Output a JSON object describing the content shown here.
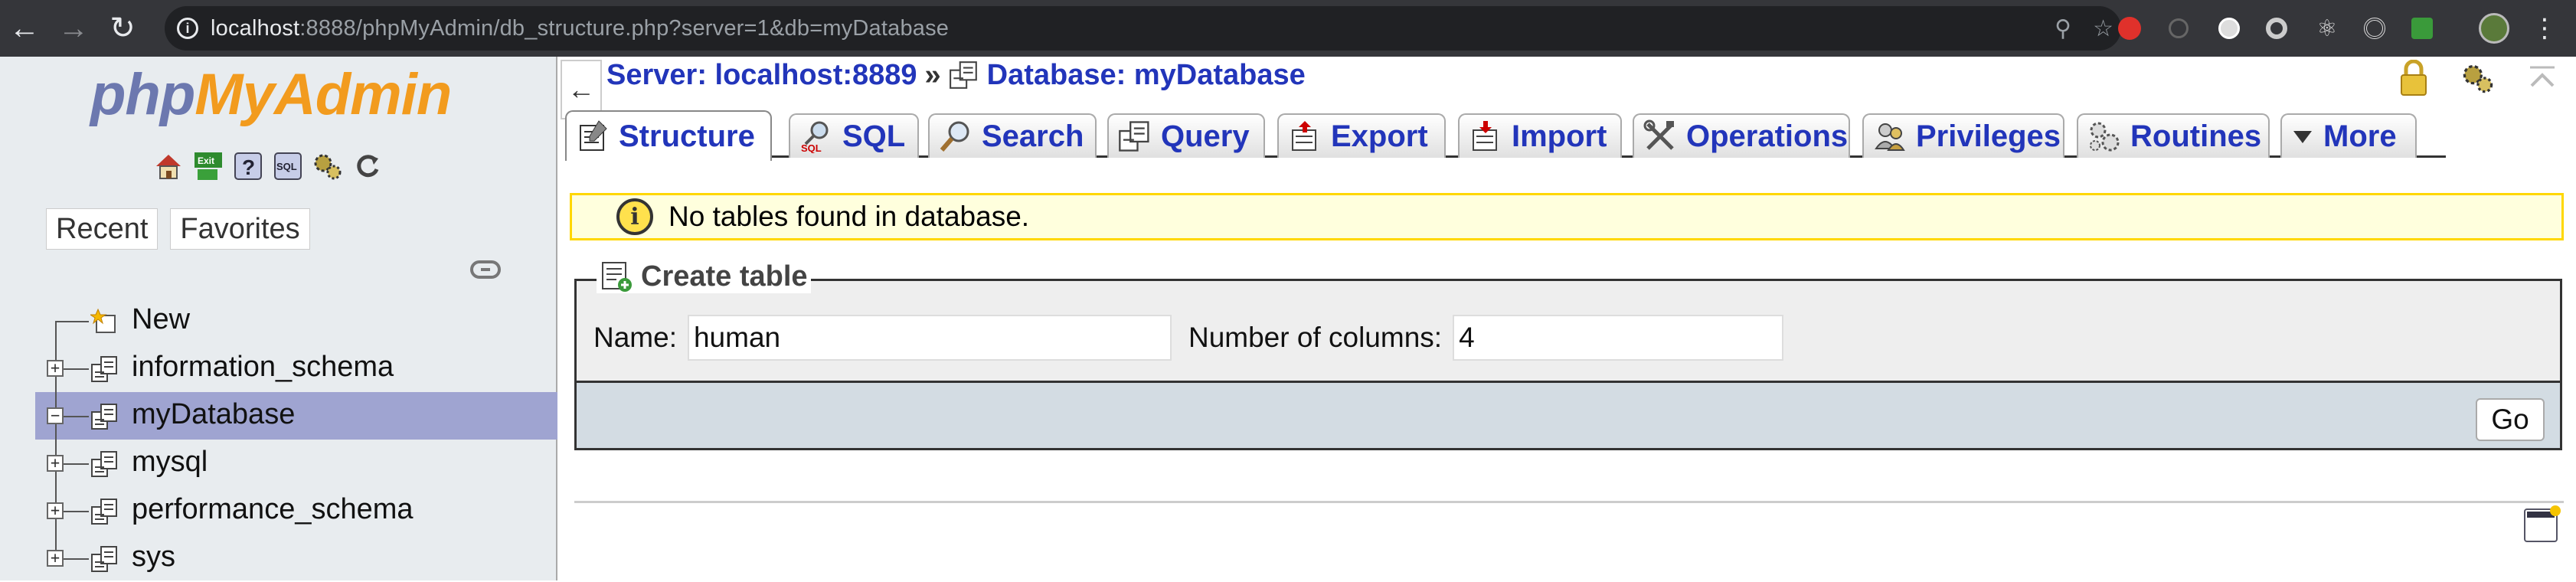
{
  "browser": {
    "url_host": "localhost",
    "url_path": ":8888/phpMyAdmin/db_structure.php?server=1&db=myDatabase"
  },
  "navigation": {
    "logo_php": "php",
    "logo_my": "MyAdmin",
    "recent_label": "Recent",
    "favorites_label": "Favorites",
    "tree": [
      {
        "label": "New",
        "type": "new"
      },
      {
        "label": "information_schema",
        "type": "db",
        "expander": "+"
      },
      {
        "label": "myDatabase",
        "type": "db",
        "expander": "−",
        "selected": true
      },
      {
        "label": "mysql",
        "type": "db",
        "expander": "+"
      },
      {
        "label": "performance_schema",
        "type": "db",
        "expander": "+"
      },
      {
        "label": "sys",
        "type": "db",
        "expander": "+"
      }
    ]
  },
  "breadcrumb": {
    "server": "Server: localhost:8889",
    "separator": "»",
    "database": "Database: myDatabase"
  },
  "tabs": [
    {
      "label": "Structure",
      "icon": "structure-icon",
      "active": true
    },
    {
      "label": "SQL",
      "icon": "sql-icon"
    },
    {
      "label": "Search",
      "icon": "search-icon"
    },
    {
      "label": "Query",
      "icon": "query-icon"
    },
    {
      "label": "Export",
      "icon": "export-icon"
    },
    {
      "label": "Import",
      "icon": "import-icon"
    },
    {
      "label": "Operations",
      "icon": "operations-icon"
    },
    {
      "label": "Privileges",
      "icon": "privileges-icon"
    },
    {
      "label": "Routines",
      "icon": "routines-icon"
    },
    {
      "label": "More",
      "icon": "more-icon"
    }
  ],
  "notice": "No tables found in database.",
  "create_table": {
    "legend": "Create table",
    "name_label": "Name:",
    "name_value": "human",
    "columns_label": "Number of columns:",
    "columns_value": "4",
    "go_label": "Go"
  },
  "colors": {
    "link_blue": "#2235ba",
    "nav_bg": "#e8ecef",
    "selected_bg": "#9fa4d1",
    "notice_bg": "#ffffdd",
    "notice_border": "#ffd700"
  }
}
